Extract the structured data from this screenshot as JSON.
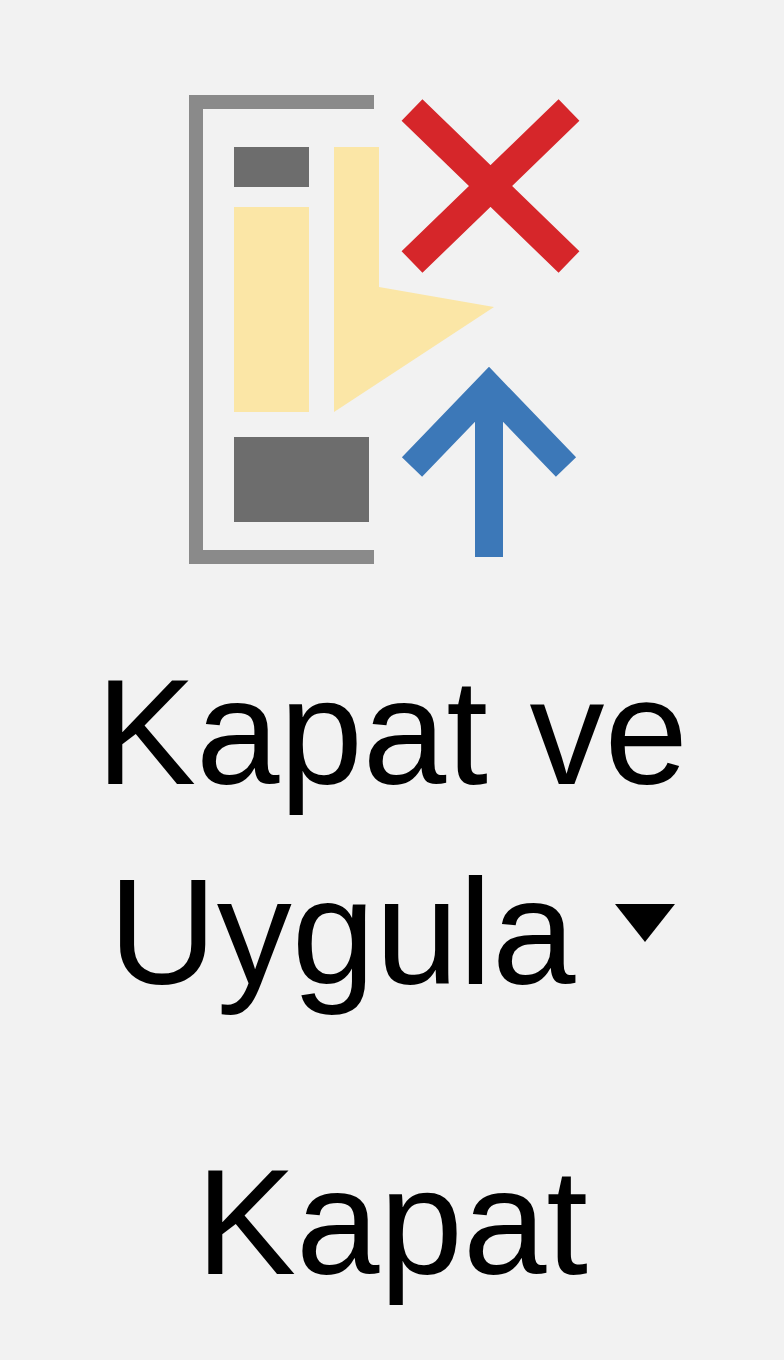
{
  "ribbon_group": {
    "label": "Kapat",
    "buttons": [
      {
        "label": "Kapat ve Uygula",
        "has_dropdown": true
      }
    ]
  }
}
